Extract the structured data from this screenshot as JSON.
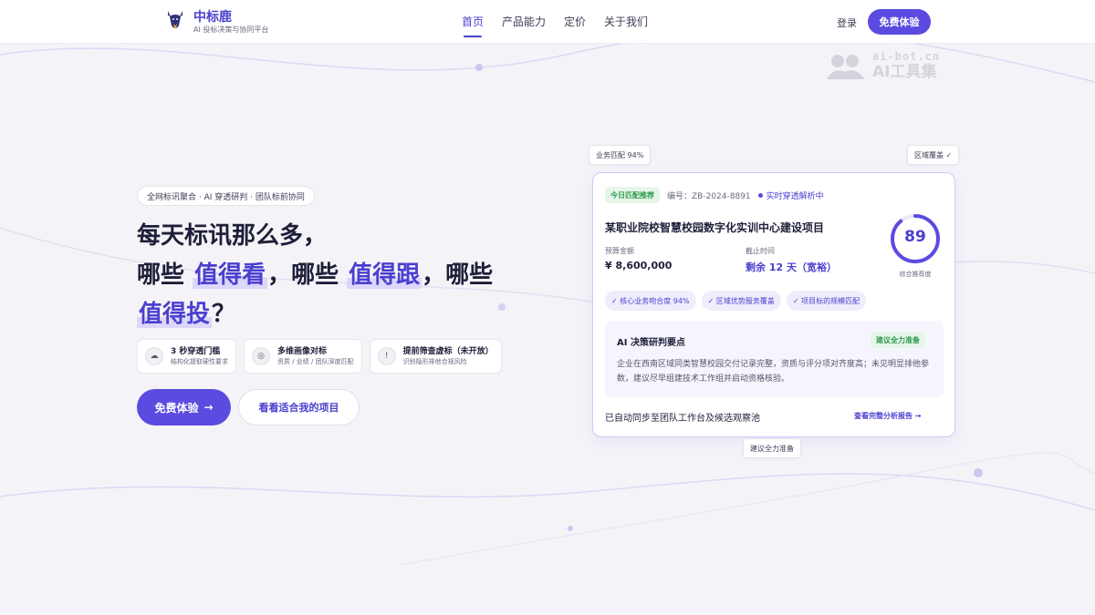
{
  "header": {
    "brand": "中标鹿",
    "tagline": "AI 投标决策与协同平台",
    "nav": [
      {
        "label": "首页",
        "active": true
      },
      {
        "label": "产品能力",
        "active": false
      },
      {
        "label": "定价",
        "active": false
      },
      {
        "label": "关于我们",
        "active": false
      }
    ],
    "login": "登录",
    "trial": "免费体验"
  },
  "watermark": {
    "domain": "ai-bot.cn",
    "name": "AI工具集"
  },
  "hero": {
    "tag": "全网标讯聚合 · AI 穿透研判 · 团队标前协同",
    "line1": "每天标讯那么多，",
    "line2_a": "哪些 ",
    "hl1": "值得看",
    "line2_b": "，哪些 ",
    "hl2": "值得跟",
    "line2_c": "，哪些",
    "hl3": "值得投",
    "line3_end": "？",
    "features": [
      {
        "icon": "cloud-icon",
        "glyph": "☁",
        "title": "3 秒穿透门槛",
        "sub": "结构化提取硬性要求"
      },
      {
        "icon": "target-icon",
        "glyph": "◎",
        "title": "多维画像对标",
        "sub": "资质 / 业绩 / 团队深度匹配"
      },
      {
        "icon": "info-icon",
        "glyph": "!",
        "title": "提前筛查虚标（未开放）",
        "sub": "识别隐形排他合规风险"
      }
    ],
    "primary_cta": "免费体验",
    "primary_arrow": "→",
    "secondary_cta": "看看适合我的项目"
  },
  "chips": {
    "business_match": "业务匹配 94%",
    "region": "区域覆盖 ✓",
    "prepare": "建议全力准备"
  },
  "card": {
    "badge": "今日匹配推荐",
    "code": "编号：ZB-2024-8891",
    "live": "实时穿透解析中",
    "title": "某职业院校智慧校园数字化实训中心建设项目",
    "budget_label": "预算金额",
    "budget_value": "¥ 8,600,000",
    "deadline_label": "截止时间",
    "deadline_value": "剩余 12 天（宽裕）",
    "score": 89,
    "score_label": "综合推荐度",
    "tags": [
      "✓ 核心业务吻合度 94%",
      "✓ 区域优势服务覆盖",
      "✓ 项目标的规模匹配"
    ],
    "ai_title": "AI 决策研判要点",
    "ai_badge": "建议全力准备",
    "ai_body": "企业在西南区域同类智慧校园交付记录完整，资质与评分项对齐度高；未见明显排他参数，建议尽早组建技术工作组并启动资格核验。",
    "footer": "已自动同步至团队工作台及候选观察池",
    "link": "查看完整分析报告 →"
  },
  "colors": {
    "accent": "#5b4be0",
    "accent_text": "#4b3fcf",
    "success": "#2f9a4d"
  }
}
